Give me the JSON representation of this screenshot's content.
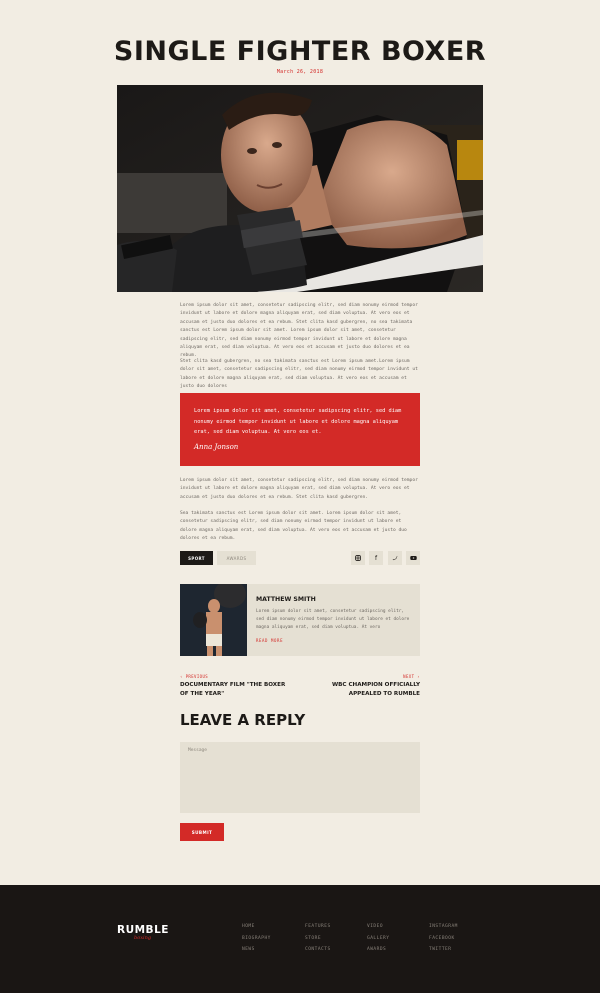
{
  "post": {
    "title": "SINGLE FIGHTER BOXER",
    "date": "March 26, 2018",
    "paragraphs": [
      "Lorem ipsum dolor sit amet, consetetur sadipscing elitr, sed diam nonumy eirmod tempor invidunt ut labore et dolore magna aliquyam erat, sed diam voluptua. At vero eos et accusam et justo duo dolores et ea rebum. Stet clita kasd gubergren, no sea takimata sanctus est Lorem ipsum dolor sit amet. Lorem ipsum dolor sit amet, consetetur sadipscing elitr, sed diam nonumy eirmod tempor invidunt ut labore et dolore magna aliquyam erat, sed diam voluptua. At vero eos et accusam et justo duo dolores et ea rebum.",
      "Stet clita kasd gubergren, no sea takimata sanctus est Lorem ipsum amet.Lorem ipsum dolor sit amet, consetetur sadipscing elitr, sed diam nonumy eirmod tempor invidunt ut labore et dolore magna aliquyam erat, sed diam voluptua. At vero eos et accusam et justo duo dolores",
      "Lorem ipsum dolor sit amet, consetetur sadipscing elitr, sed diam nonumy eirmod tempor invidunt ut labore et dolore magna aliquyam erat, sed diam voluptua. At vero eos et accusam et justo duo dolores et ea rebum. Stet clita kasd gubergren.",
      "Sea takimata sanctus est Lorem ipsum dolor sit amet. Lorem ipsum dolor sit amet, consetetur sadipscing elitr, sed diam nonumy eirmod tempor invidunt ut labore et dolore magna aliquyam erat, sed diam voluptua. At vero eos et accusam et justo duo dolores et ea rebum."
    ],
    "quote": {
      "text": "Lorem ipsum dolor sit amet, consetetur sadipscing elitr, sed diam nonumy eirmod tempor invidunt ut labore et dolore magna aliquyam erat, sed diam voluptua. At vero eos et.",
      "signature": "Anna Jonson"
    },
    "tags": [
      "SPORT",
      "AWARDS"
    ],
    "social_icons": [
      "instagram-icon",
      "facebook-icon",
      "twitter-icon",
      "youtube-icon"
    ]
  },
  "author": {
    "name": "MATTHEW SMITH",
    "bio": "Lorem ipsum dolor sit amet, consetetur sadipscing elitr, sed diam nonumy eirmod tempor invidunt ut labore et dolore magna aliquyam erat, sed diam voluptua. At vero",
    "read_more": "READ MORE"
  },
  "nav": {
    "prev_label": "‹ PREVIOUS",
    "prev_title": "DOCUMENTARY FILM \"THE BOXER OF THE YEAR\"",
    "next_label": "NEXT ›",
    "next_title": "WBC CHAMPION OFFICIALLY APPEALED TO RUMBLE"
  },
  "reply": {
    "heading": "LEAVE A REPLY",
    "message_placeholder": "Message",
    "submit": "SUBMIT"
  },
  "footer": {
    "logo": "RUMBLE",
    "logo_sub": "boxing",
    "columns": [
      [
        "HOME",
        "BIOGRAPHY",
        "NEWS"
      ],
      [
        "FEATURES",
        "STORE",
        "CONTACTS"
      ],
      [
        "VIDEO",
        "GALLERY",
        "AWARDS"
      ],
      [
        "INSTAGRAM",
        "FACEBOOK",
        "TWITTER"
      ]
    ]
  },
  "colors": {
    "accent": "#d32a27",
    "background": "#f2ede3",
    "dark": "#1a1614",
    "panel": "#e5e0d3"
  }
}
